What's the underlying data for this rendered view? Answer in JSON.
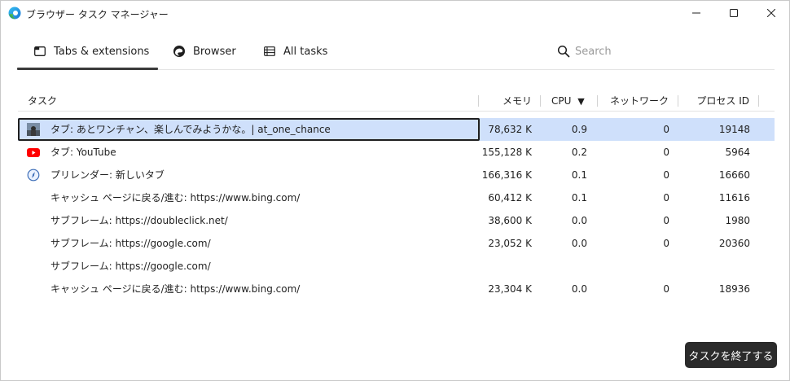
{
  "window": {
    "title": "ブラウザー タスク マネージャー",
    "icons": {
      "app": "edge-logo-icon",
      "minimize": "minimize-icon",
      "maximize": "maximize-icon",
      "close": "close-icon"
    }
  },
  "tabs": [
    {
      "label": "Tabs & extensions",
      "icon": "tab-window-icon",
      "active": true
    },
    {
      "label": "Browser",
      "icon": "edge-browser-icon",
      "active": false
    },
    {
      "label": "All tasks",
      "icon": "list-grid-icon",
      "active": false
    }
  ],
  "search": {
    "placeholder": "Search",
    "value": "",
    "icon": "search-icon"
  },
  "table": {
    "columns": {
      "task": "タスク",
      "memory": "メモリ",
      "cpu": "CPU",
      "cpu_sort": "▼",
      "network": "ネットワーク",
      "pid": "プロセス ID"
    },
    "rows": [
      {
        "icon": "thumbnail-icon",
        "title": "タブ: あとワンチャン、楽しんでみようかな。| at_one_chance",
        "memory": "78,632 K",
        "cpu": "0.9",
        "network": "0",
        "pid": "19148",
        "selected": true
      },
      {
        "icon": "youtube-icon",
        "title": "タブ: YouTube",
        "memory": "155,128 K",
        "cpu": "0.2",
        "network": "0",
        "pid": "5964",
        "selected": false
      },
      {
        "icon": "prerender-compass-icon",
        "title": "プリレンダー: 新しいタブ",
        "memory": "166,316 K",
        "cpu": "0.1",
        "network": "0",
        "pid": "16660",
        "selected": false
      },
      {
        "icon": "",
        "title": "キャッシュ ページに戻る/進む: https://www.bing.com/",
        "memory": "60,412 K",
        "cpu": "0.1",
        "network": "0",
        "pid": "11616",
        "selected": false
      },
      {
        "icon": "",
        "title": "サブフレーム: https://doubleclick.net/",
        "memory": "38,600 K",
        "cpu": "0.0",
        "network": "0",
        "pid": "1980",
        "selected": false
      },
      {
        "icon": "",
        "title": "サブフレーム: https://google.com/",
        "memory": "23,052 K",
        "cpu": "0.0",
        "network": "0",
        "pid": "20360",
        "selected": false
      },
      {
        "icon": "",
        "title": "サブフレーム: https://google.com/",
        "memory": "",
        "cpu": "",
        "network": "",
        "pid": "",
        "selected": false
      },
      {
        "icon": "",
        "title": "キャッシュ ページに戻る/進む: https://www.bing.com/",
        "memory": "23,304 K",
        "cpu": "0.0",
        "network": "0",
        "pid": "18936",
        "selected": false
      }
    ]
  },
  "end_task": {
    "label": "タスクを終了する"
  },
  "colors": {
    "selection": "#cfe0fb",
    "button_bg": "#2b2b2b",
    "youtube_red": "#ff0000"
  }
}
